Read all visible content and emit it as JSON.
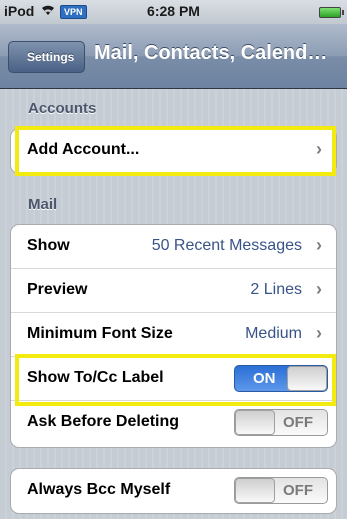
{
  "status_bar": {
    "carrier": "iPod",
    "vpn_badge": "VPN",
    "time": "6:28 PM",
    "wifi_icon": "wifi-icon",
    "battery_icon": "battery-icon"
  },
  "nav": {
    "back_label": "Settings",
    "title": "Mail, Contacts, Calend…"
  },
  "sections": {
    "accounts": {
      "header": "Accounts",
      "add_account_label": "Add Account...",
      "chevron": "›"
    },
    "mail": {
      "header": "Mail",
      "rows": [
        {
          "label": "Show",
          "value": "50 Recent Messages",
          "chevron": "›"
        },
        {
          "label": "Preview",
          "value": "2 Lines",
          "chevron": "›"
        },
        {
          "label": "Minimum Font Size",
          "value": "Medium",
          "chevron": "›"
        },
        {
          "label": "Show To/Cc Label",
          "toggle": "ON"
        },
        {
          "label": "Ask Before Deleting",
          "toggle": "OFF"
        }
      ]
    },
    "bcc": {
      "label": "Always Bcc Myself",
      "toggle": "OFF"
    }
  },
  "colors": {
    "highlight": "#f3ea0f",
    "value_blue": "#385487",
    "toggle_on": "#2b6fd6"
  }
}
